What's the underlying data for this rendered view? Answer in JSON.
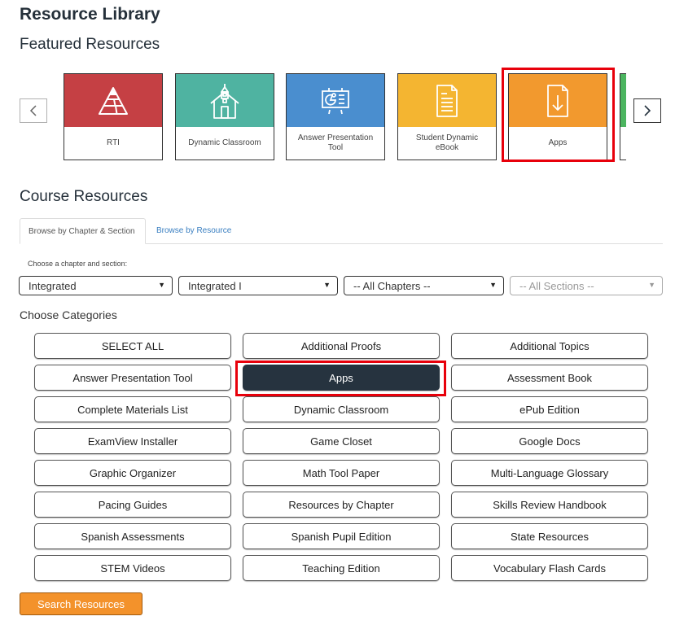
{
  "header": {
    "title": "Resource Library",
    "featured_title": "Featured Resources"
  },
  "carousel": {
    "prev_icon": "chevron-left-icon",
    "next_icon": "chevron-right-icon",
    "tiles": [
      {
        "label": "RTI",
        "icon": "pyramid-icon",
        "color": "#c54044"
      },
      {
        "label": "Dynamic Classroom",
        "icon": "schoolhouse-icon",
        "color": "#4fb3a1"
      },
      {
        "label": "Answer Presentation Tool",
        "icon": "presentation-easel-icon",
        "color": "#4a8ecf"
      },
      {
        "label": "Student Dynamic eBook",
        "icon": "document-icon",
        "color": "#f4b531"
      },
      {
        "label": "Apps",
        "icon": "download-file-icon",
        "color": "#f2992e",
        "highlighted": true
      },
      {
        "label": "",
        "icon": "",
        "color": "#4cb560",
        "partial": true
      }
    ]
  },
  "course": {
    "title": "Course Resources",
    "tabs": [
      {
        "label": "Browse by Chapter & Section",
        "active": true
      },
      {
        "label": "Browse by Resource",
        "active": false
      }
    ],
    "choose_label": "Choose a chapter and section:",
    "selects": [
      {
        "value": "Integrated",
        "disabled": false
      },
      {
        "value": "Integrated I",
        "disabled": false
      },
      {
        "value": "-- All Chapters --",
        "disabled": false
      },
      {
        "value": "-- All Sections --",
        "disabled": true
      }
    ],
    "categories_title": "Choose Categories",
    "categories": [
      {
        "label": "SELECT ALL",
        "selected": false
      },
      {
        "label": "Additional Proofs",
        "selected": false
      },
      {
        "label": "Additional Topics",
        "selected": false
      },
      {
        "label": "Answer Presentation Tool",
        "selected": false
      },
      {
        "label": "Apps",
        "selected": true
      },
      {
        "label": "Assessment Book",
        "selected": false
      },
      {
        "label": "Complete Materials List",
        "selected": false
      },
      {
        "label": "Dynamic Classroom",
        "selected": false
      },
      {
        "label": "ePub Edition",
        "selected": false
      },
      {
        "label": "ExamView Installer",
        "selected": false
      },
      {
        "label": "Game Closet",
        "selected": false
      },
      {
        "label": "Google Docs",
        "selected": false
      },
      {
        "label": "Graphic Organizer",
        "selected": false
      },
      {
        "label": "Math Tool Paper",
        "selected": false
      },
      {
        "label": "Multi-Language Glossary",
        "selected": false
      },
      {
        "label": "Pacing Guides",
        "selected": false
      },
      {
        "label": "Resources by Chapter",
        "selected": false
      },
      {
        "label": "Skills Review Handbook",
        "selected": false
      },
      {
        "label": "Spanish Assessments",
        "selected": false
      },
      {
        "label": "Spanish Pupil Edition",
        "selected": false
      },
      {
        "label": "State Resources",
        "selected": false
      },
      {
        "label": "STEM Videos",
        "selected": false
      },
      {
        "label": "Teaching Edition",
        "selected": false
      },
      {
        "label": "Vocabulary Flash Cards",
        "selected": false
      }
    ],
    "search_button": "Search Resources"
  },
  "colors": {
    "highlight": "#e8000b",
    "selected_category": "#26333f",
    "search_button": "#f3922b",
    "tab_link": "#3a7fc1"
  }
}
